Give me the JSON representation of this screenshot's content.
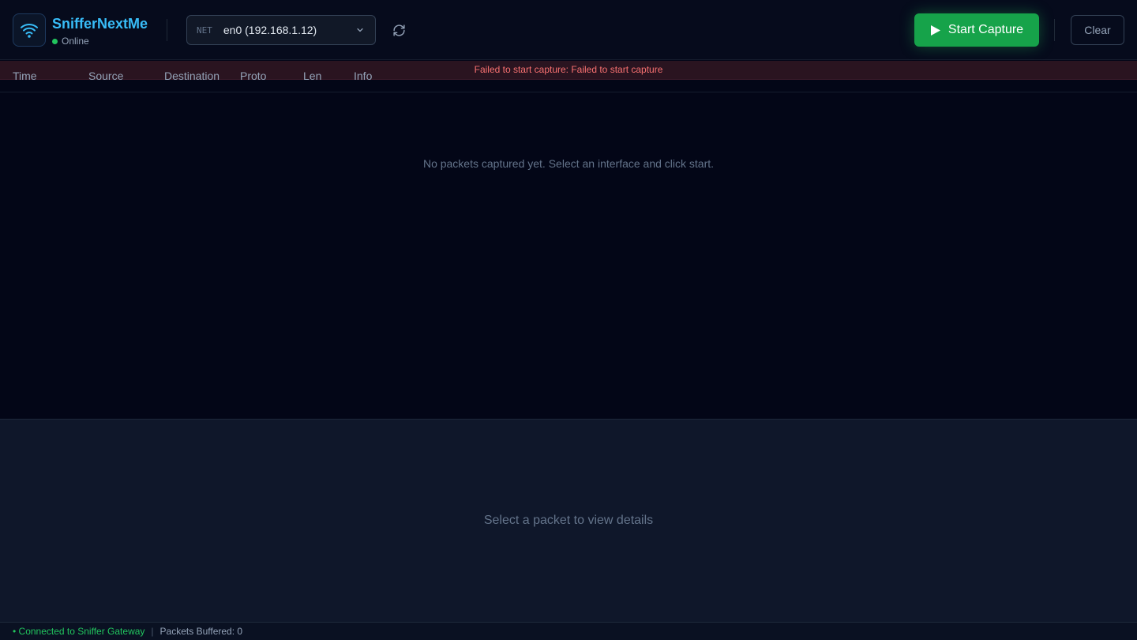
{
  "app": {
    "name": "SnifferNextMe",
    "status": "Online"
  },
  "interface": {
    "tag": "NET",
    "selected": "en0 (192.168.1.12)"
  },
  "toolbar": {
    "start_label": "Start Capture",
    "clear_label": "Clear"
  },
  "error": {
    "message": "Failed to start capture: Failed to start capture"
  },
  "table": {
    "columns": [
      "Time",
      "Source",
      "Destination",
      "Proto",
      "Len",
      "Info"
    ],
    "empty_message": "No packets captured yet. Select an interface and click start."
  },
  "details": {
    "empty_message": "Select a packet to view details"
  },
  "footer": {
    "connection": "• Connected to Sniffer Gateway",
    "separator": "|",
    "buffered": "Packets Buffered: 0"
  },
  "colors": {
    "accent": "#38bdf8",
    "success": "#16a34a",
    "error": "#f87171",
    "background": "#030617"
  },
  "icons": {
    "logo": "wifi-icon",
    "refresh": "refresh-icon",
    "start": "play-icon",
    "dropdown": "chevron-down-icon"
  }
}
